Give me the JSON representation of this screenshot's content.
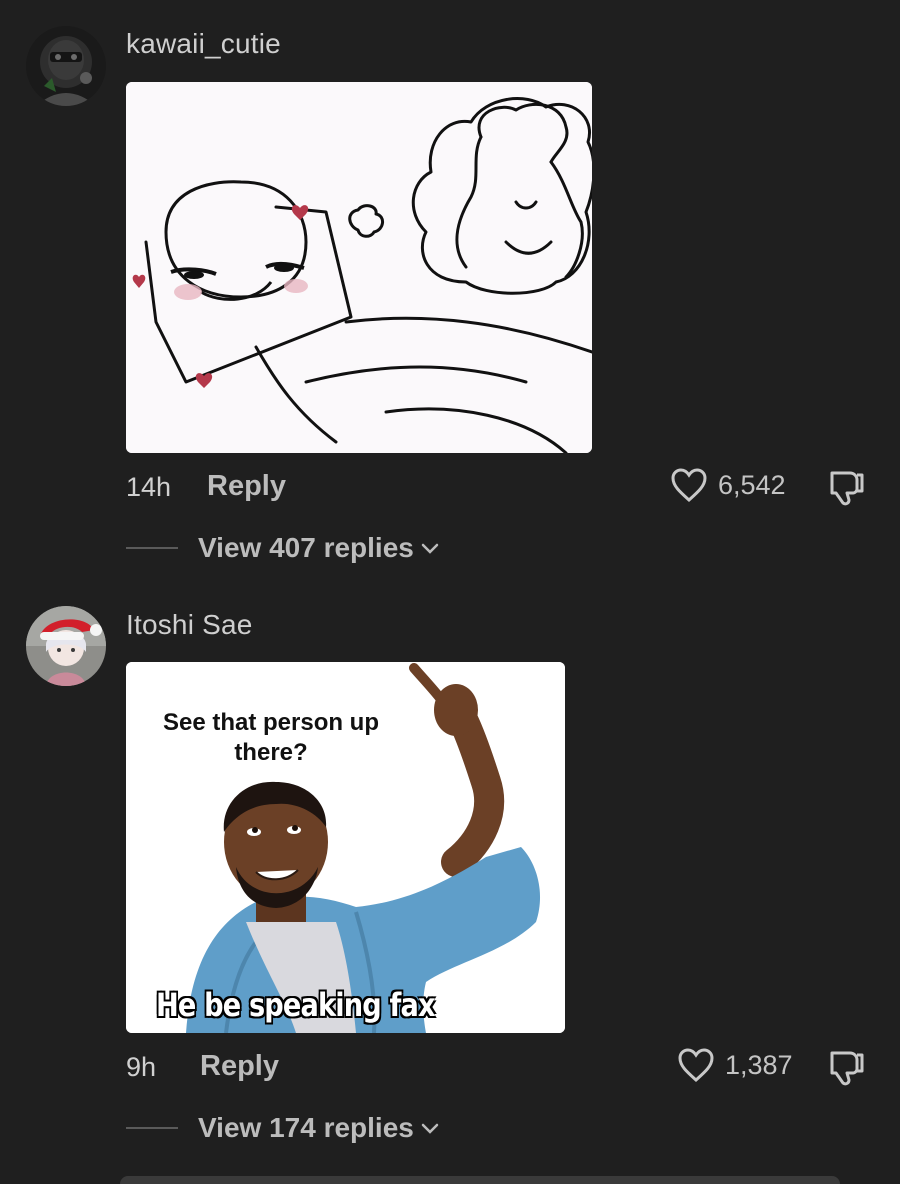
{
  "comments": [
    {
      "username": "kawaii_cutie",
      "time": "14h",
      "reply_label": "Reply",
      "likes": "6,542",
      "view_replies": "View 407 replies",
      "media": "stick figure doodle image"
    },
    {
      "username": "Itoshi Sae",
      "time": "9h",
      "reply_label": "Reply",
      "likes": "1,387",
      "view_replies": "View 174 replies",
      "meme_top": "See that person up there?",
      "meme_bottom": "He be speaking fax"
    }
  ],
  "colors": {
    "background": "#1f1f1f",
    "text": "#d6d6d6",
    "muted": "#bcbcbc",
    "heart": "#d86b7a"
  }
}
